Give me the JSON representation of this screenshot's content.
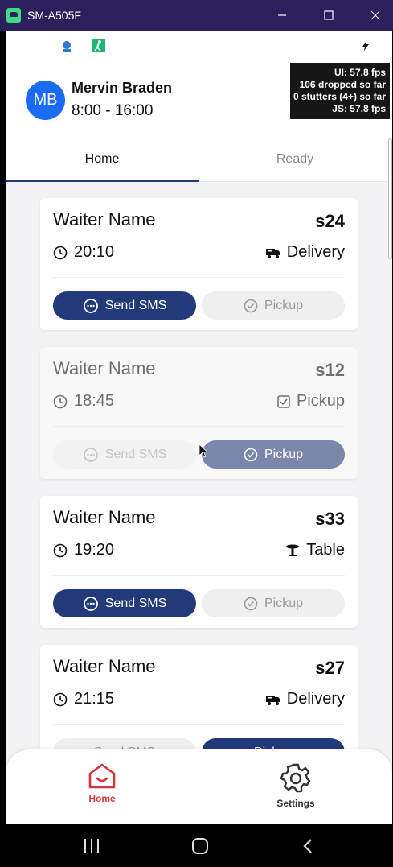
{
  "window": {
    "title": "SM-A505F"
  },
  "user": {
    "initials": "MB",
    "name": "Mervin Braden",
    "shift": "8:00 - 16:00"
  },
  "perf_overlay": {
    "line1": "UI: 57.8 fps",
    "line2": "106 dropped so far",
    "line3": "0 stutters (4+) so far",
    "line4": "JS: 57.8 fps"
  },
  "tabs": [
    {
      "label": "Home",
      "active": true
    },
    {
      "label": "Ready",
      "active": false
    }
  ],
  "orders": [
    {
      "waiter": "Waiter Name",
      "code": "s24",
      "time": "20:10",
      "type": "Delivery",
      "type_icon": "delivery-truck-icon",
      "sms_label": "Send SMS",
      "pickup_label": "Pickup",
      "sms_enabled": true,
      "pickup_done": false
    },
    {
      "waiter": "Waiter Name",
      "code": "s12",
      "time": "18:45",
      "type": "Pickup",
      "type_icon": "checkbox-icon",
      "sms_label": "Send SMS",
      "pickup_label": "Pickup",
      "sms_enabled": false,
      "pickup_done": true
    },
    {
      "waiter": "Waiter Name",
      "code": "s33",
      "time": "19:20",
      "type": "Table",
      "type_icon": "table-icon",
      "sms_label": "Send SMS",
      "pickup_label": "Pickup",
      "sms_enabled": true,
      "pickup_done": false
    },
    {
      "waiter": "Waiter Name",
      "code": "s27",
      "time": "21:15",
      "type": "Delivery",
      "type_icon": "delivery-truck-icon",
      "sms_label": "Send SMS",
      "pickup_label": "Pickup",
      "sms_enabled": false,
      "pickup_done": true
    }
  ],
  "bottom_nav": [
    {
      "label": "Home",
      "icon": "home-icon",
      "active": true
    },
    {
      "label": "Settings",
      "icon": "gear-icon",
      "active": false
    }
  ],
  "colors": {
    "primary": "#223a7a",
    "accent_red": "#d6343f",
    "avatar": "#1a6cf5",
    "title_bar": "#2b1f5c"
  }
}
